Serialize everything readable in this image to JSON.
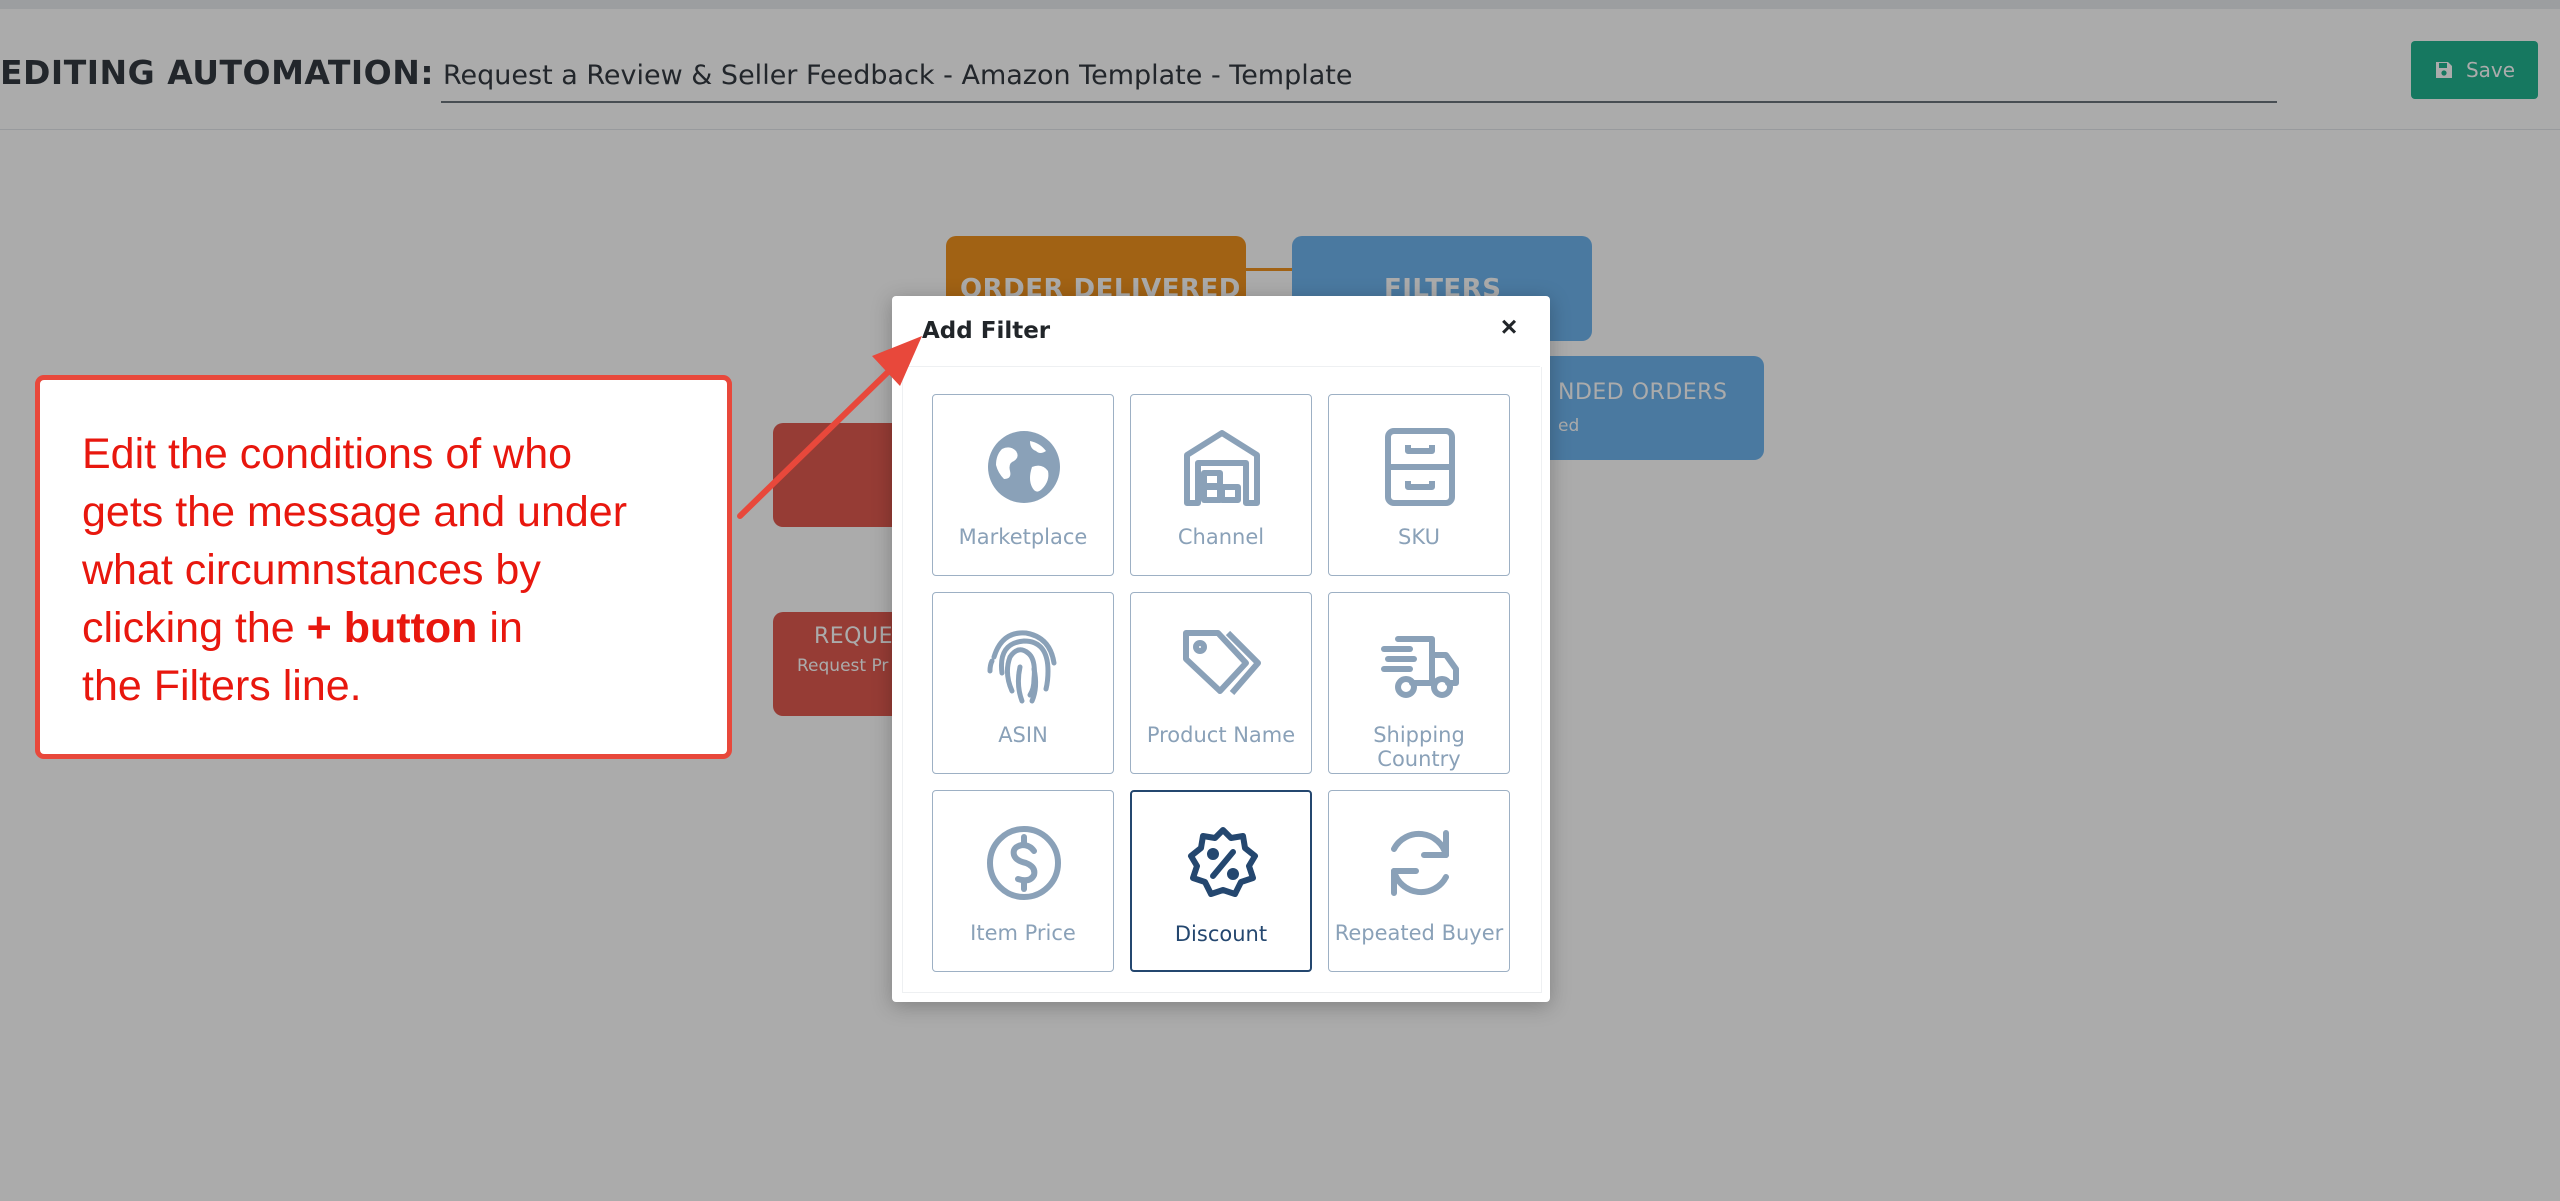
{
  "header": {
    "label": "EDITING AUTOMATION:",
    "title_value": "Request a Review & Seller Feedback - Amazon Template - Template",
    "save_label": "Save"
  },
  "workflow": {
    "trigger": "ORDER DELIVERED",
    "filters": "FILTERS",
    "refunded_title": "NDED ORDERS",
    "refunded_sub": "ed",
    "request_title": "REQUE",
    "request_sub": "Request Pr"
  },
  "modal": {
    "title": "Add Filter",
    "close": "×",
    "tiles": [
      {
        "label": "Marketplace",
        "icon": "globe-icon"
      },
      {
        "label": "Channel",
        "icon": "warehouse-icon"
      },
      {
        "label": "SKU",
        "icon": "file-cabinet-icon"
      },
      {
        "label": "ASIN",
        "icon": "fingerprint-icon"
      },
      {
        "label": "Product Name",
        "icon": "tags-icon"
      },
      {
        "label": "Shipping Country",
        "icon": "shipping-truck-icon"
      },
      {
        "label": "Item Price",
        "icon": "dollar-circle-icon"
      },
      {
        "label": "Discount",
        "icon": "percent-badge-icon"
      },
      {
        "label": "Repeated Buyer",
        "icon": "repeat-icon"
      }
    ]
  },
  "callout": {
    "line1": "Edit the conditions of who",
    "line2": "gets the message and under",
    "line3": "what circumnstances by",
    "line4_pre": "clicking the ",
    "line4_bold": "+ button",
    "line4_post": " in",
    "line5": "the Filters line."
  },
  "colors": {
    "save": "#21b38f",
    "trigger": "#f0931e",
    "filters": "#6fb5ef",
    "request": "#e05a4f",
    "callout_border": "#e8483b",
    "callout_text": "#e8170e",
    "icon_muted": "#8aa1b8",
    "icon_active": "#24476f"
  }
}
